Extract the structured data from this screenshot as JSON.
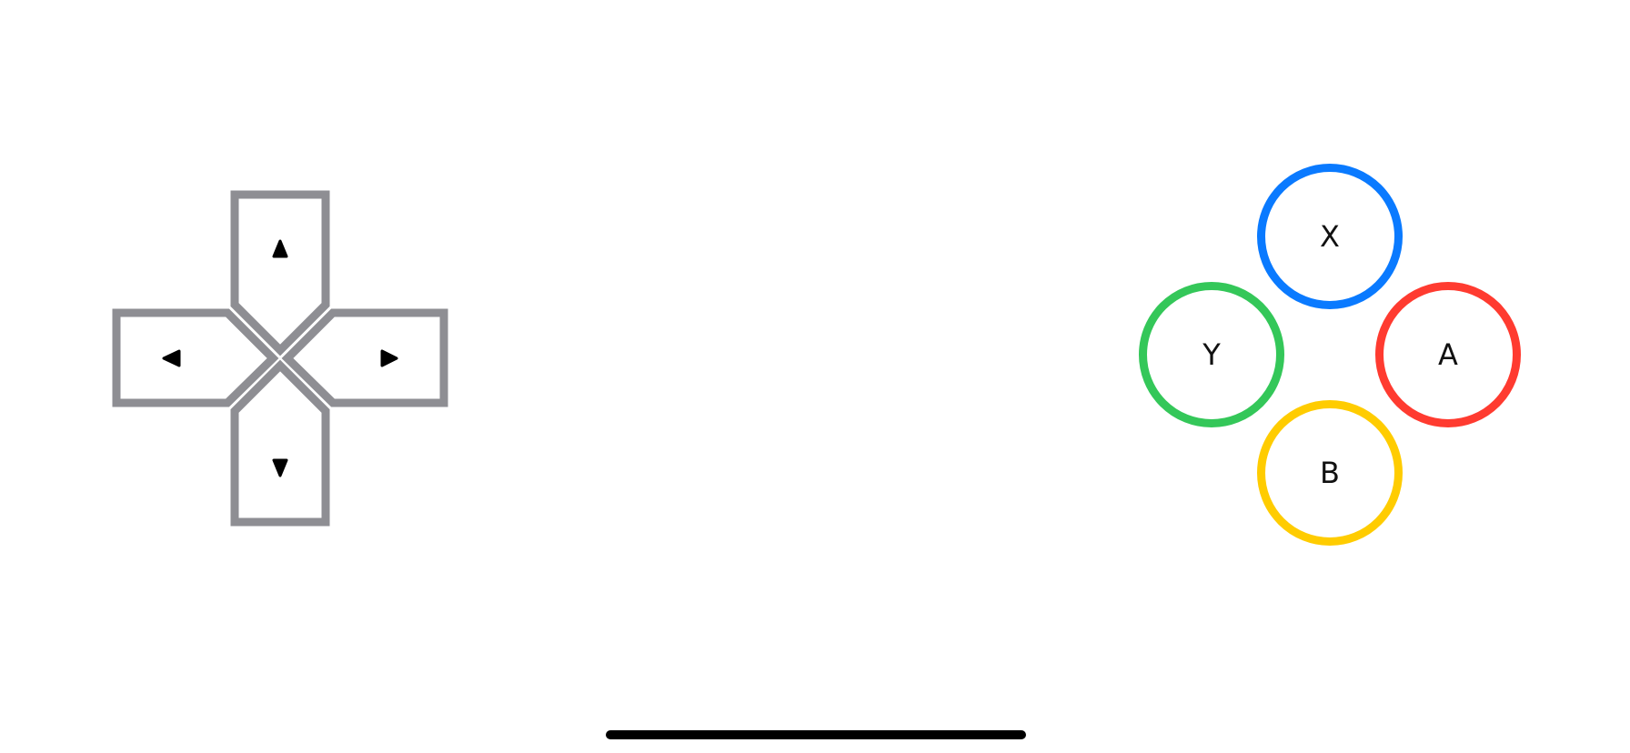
{
  "dpad": {
    "border_color": "#8e8e93",
    "arrow_color": "#000000",
    "buttons": [
      {
        "direction": "up",
        "icon": "triangle-up-icon"
      },
      {
        "direction": "left",
        "icon": "triangle-left-icon"
      },
      {
        "direction": "right",
        "icon": "triangle-right-icon"
      },
      {
        "direction": "down",
        "icon": "triangle-down-icon"
      }
    ]
  },
  "face_buttons": {
    "x": {
      "label": "X",
      "color": "#0a7aff"
    },
    "y": {
      "label": "Y",
      "color": "#34c759"
    },
    "a": {
      "label": "A",
      "color": "#ff3b30"
    },
    "b": {
      "label": "B",
      "color": "#ffcc00"
    }
  },
  "home_indicator": {
    "color": "#000000"
  }
}
